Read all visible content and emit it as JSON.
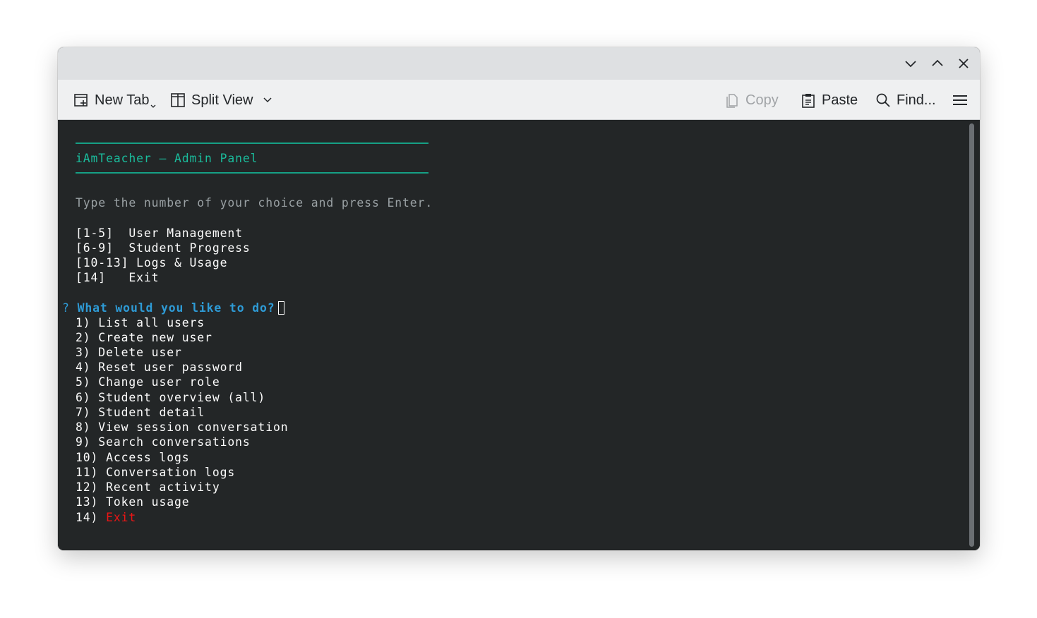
{
  "colors": {
    "titlebar_bg": "#dee0e2",
    "toolbar_bg": "#eff0f1",
    "terminal_bg": "#232627",
    "terminal_fg": "#fcfcfc",
    "accent_teal": "#1abc9c",
    "prompt_blue": "#2e9bd6",
    "exit_red": "#ed1515",
    "dim_text": "#9aa1a4"
  },
  "window_controls": {
    "minimize_icon": "chevron-down-icon",
    "maximize_icon": "chevron-up-icon",
    "close_icon": "close-icon"
  },
  "toolbar": {
    "new_tab_label": "New Tab",
    "split_view_label": "Split View",
    "copy_label": "Copy",
    "paste_label": "Paste",
    "find_label": "Find..."
  },
  "terminal": {
    "header_title": "iAmTeacher — Admin Panel",
    "instruction": "Type the number of your choice and press Enter.",
    "categories": [
      "[1-5]  User Management",
      "[6-9]  Student Progress",
      "[10-13] Logs & Usage",
      "[14]   Exit"
    ],
    "prompt_mark": "?",
    "prompt_question": "What would you like to do?",
    "menu": [
      "1) List all users",
      "2) Create new user",
      "3) Delete user",
      "4) Reset user password",
      "5) Change user role",
      "6) Student overview (all)",
      "7) Student detail",
      "8) View session conversation",
      "9) Search conversations",
      "10) Access logs",
      "11) Conversation logs",
      "12) Recent activity",
      "13) Token usage"
    ],
    "exit_number": "14)",
    "exit_label": "Exit"
  }
}
